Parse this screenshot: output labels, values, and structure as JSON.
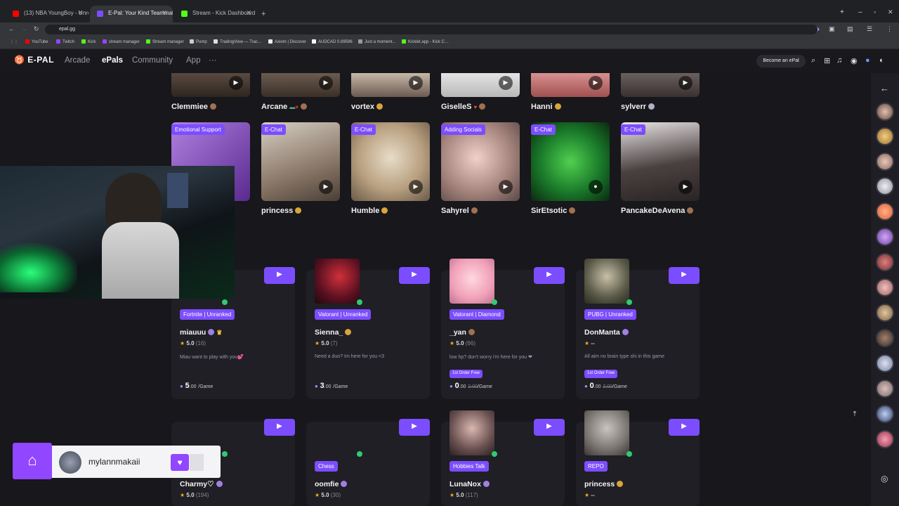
{
  "browser": {
    "tabs": [
      {
        "label": "(13) NBA YoungBoy - Unrelease",
        "active": false,
        "color": "#ff0000"
      },
      {
        "label": "E-Pal: Your Kind Teammates",
        "active": true,
        "color": "#7c4dff"
      },
      {
        "label": "Stream - Kick Dashboard",
        "active": false,
        "color": "#53fc18"
      }
    ],
    "url": "epal.gg",
    "bookmarks": [
      "YouTube",
      "Twitch",
      "Kick",
      "stream manager",
      "Stream manager",
      "Pump",
      "TradingView — Trac…",
      "Axiom | Discover",
      "AUDCAD 0.89596",
      "Just a moment...",
      "Kicklet.app - Kick C…"
    ]
  },
  "nav": {
    "logo": "E-PAL",
    "links": [
      "Arcade",
      "ePals",
      "Community",
      "App"
    ],
    "more": "···",
    "become_label": "Become an ePal"
  },
  "top_row": [
    {
      "name": "Clemmiee"
    },
    {
      "name": "Arcane"
    },
    {
      "name": "vortex"
    },
    {
      "name": "GiselleS"
    },
    {
      "name": "Hanni"
    },
    {
      "name": "sylverr"
    }
  ],
  "second_row": [
    {
      "tag": "Emotional Support",
      "name": ""
    },
    {
      "tag": "E-Chat",
      "name": "princess"
    },
    {
      "tag": "E-Chat",
      "name": "Humble"
    },
    {
      "tag": "Adding Socials",
      "name": "Sahyrel"
    },
    {
      "tag": "E-Chat",
      "name": "SirEtsotic"
    },
    {
      "tag": "E-Chat",
      "name": "PancakeDeAvena"
    }
  ],
  "cards": [
    {
      "tag": "Fortnite | Unranked",
      "name": "miauuu",
      "rating": "5.0",
      "count": "(16)",
      "bio": "Miau want to play with you💕",
      "price": "5",
      "price_dec": ".00",
      "unit": "/Game",
      "promo": "",
      "old_price": ""
    },
    {
      "tag": "Valorant | Unranked",
      "name": "Sienna_",
      "rating": "5.0",
      "count": "(7)",
      "bio": "Need a duo? Im here for you <3",
      "price": "3",
      "price_dec": ".00",
      "unit": "/Game",
      "promo": "",
      "old_price": ""
    },
    {
      "tag": "Valorant | Diamond",
      "name": "_yan",
      "rating": "5.0",
      "count": "(66)",
      "bio": "low hp? don't worry i'm here for you ❤",
      "price": "0",
      "price_dec": ".00",
      "unit": "/Game",
      "promo": "1st Order Free",
      "old_price": "2.00"
    },
    {
      "tag": "PUBG | Unranked",
      "name": "DonManta",
      "rating": "--",
      "count": "",
      "bio": "All aim no brain type shi in this game",
      "price": "0",
      "price_dec": ".00",
      "unit": "/Game",
      "promo": "1st Order Free",
      "old_price": "2.00"
    }
  ],
  "bottom_cards": [
    {
      "tag": "",
      "name": "Charmy♡",
      "rating": "5.0",
      "count": "(194)"
    },
    {
      "tag": "Chess",
      "name": "oomfie",
      "rating": "5.0",
      "count": "(30)"
    },
    {
      "tag": "Hobbies Talk",
      "name": "LunaNox",
      "rating": "5.0",
      "count": "(117)"
    },
    {
      "tag": "REPO",
      "name": "princess",
      "rating": "--",
      "count": ""
    }
  ],
  "overlay": {
    "twitch_username": "mylannmakaii"
  },
  "colors": {
    "accent": "#7c4dff",
    "twitch": "#9146ff",
    "online": "#2ecc71",
    "background": "#17171c"
  }
}
